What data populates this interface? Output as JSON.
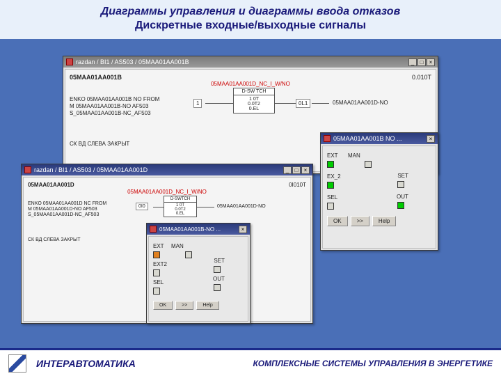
{
  "header": {
    "line1": "Диаграммы управления и диаграммы ввода отказов",
    "line2": "Дискретные входные/выходные сигналы"
  },
  "footer": {
    "brand": "ИНТЕРАВТОМАТИКА",
    "tagline": "КОМПЛЕКСНЫЕ СИСТЕМЫ УПРАВЛЕНИЯ В ЭНЕРГЕТИКЕ"
  },
  "winA": {
    "title": "razdan / BI1 / AS503 / 05MAA01AA001B",
    "signal": "05MAA01AA001B",
    "status": "0.010T",
    "redline": "05MAA01AA001D_NC_I_W/NO",
    "block_label": "D-SW TCH",
    "out_label": "05MAA01AA001D-NO",
    "in1": "ENKO 05MAA01AA001B NO FROM",
    "in2": "M 05MAA01AA001B-NO AF503",
    "in3": "S_05MAA01AA001B-NC_AF503",
    "desc": "СК ВД СЛЕВА ЗАКРЫТ",
    "p1": "1 0T",
    "p2": "0.0T2",
    "p3": "0.EL",
    "inv": "1",
    "outv": "0L1"
  },
  "winB": {
    "title": "razdan / BI1 / AS503 / 05MAA01AA001D",
    "signal": "05MAA01AA001D",
    "status": "0I010T",
    "redline": "05MAA01AA001D_NC_I_W/NO",
    "block_label": "D-SWTCH",
    "out_label": "05MAA01AA001D-NO",
    "in1": "ENKO 05MAA01AA001D NC FROM",
    "in2": "M 05MAA01AA001D-NO AF503",
    "in3": "S_05MAA01AA001D-NC_AF503",
    "desc": "СК ВД СЛЕВА ЗАКРЫТ",
    "p1": "1 0T",
    "p2": "0.0T2",
    "p3": "0.EL",
    "inv": "0I0"
  },
  "panelA": {
    "title": "05MAA01AA001B NO ...",
    "l_ext": "EXT",
    "l_man": "MAN",
    "l_ext2": "EX_2",
    "l_set": "SET",
    "l_sel": "SEL",
    "l_out": "OUT",
    "btn_ok": "OK",
    "btn_next": ">>",
    "btn_help": "Help"
  },
  "panelB": {
    "title": "05MAA01AA001B-NO ...",
    "l_ext": "EXT",
    "l_man": "MAN",
    "l_ext2": "EXT2",
    "l_set": "SET",
    "l_sel": "SEL",
    "l_out": "OUT",
    "btn_ok": "OK",
    "btn_next": ">>",
    "btn_help": "Help"
  },
  "icons": {
    "min": "_",
    "max": "□",
    "close": "×"
  }
}
